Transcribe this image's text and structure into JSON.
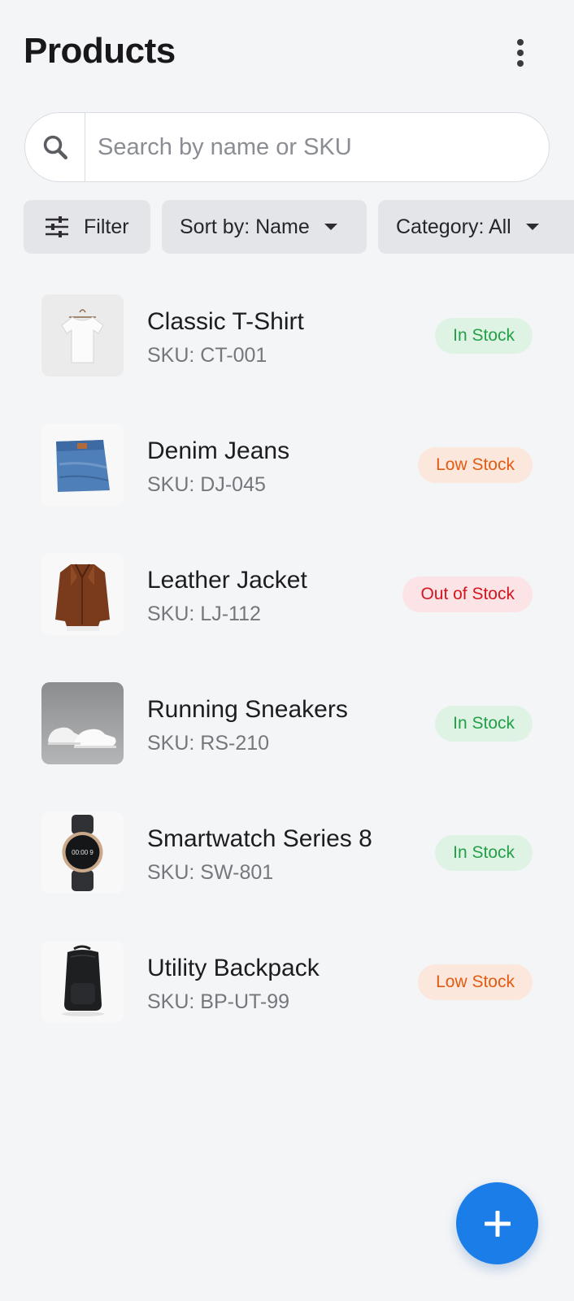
{
  "header": {
    "title": "Products",
    "more_icon": "more-vertical-icon"
  },
  "search": {
    "placeholder": "Search by name or SKU",
    "value": "",
    "icon": "search-icon"
  },
  "toolbar": {
    "filter_label": "Filter",
    "filter_icon": "sliders-icon",
    "sort_label": "Sort by: Name",
    "category_label": "Category: All"
  },
  "colors": {
    "accent": "#1b7ee8",
    "in_stock_bg": "#dff3e5",
    "in_stock_text": "#23a047",
    "low_stock_bg": "#fbe7dc",
    "low_stock_text": "#e25b12",
    "out_stock_bg": "#fbe3e6",
    "out_stock_text": "#d4161e"
  },
  "products": [
    {
      "name": "Classic T-Shirt",
      "sku": "SKU: CT-001",
      "status": "In Stock",
      "thumb": "t-shirt-image"
    },
    {
      "name": "Denim Jeans",
      "sku": "SKU: DJ-045",
      "status": "Low Stock",
      "thumb": "jeans-image"
    },
    {
      "name": "Leather Jacket",
      "sku": "SKU: LJ-112",
      "status": "Out of Stock",
      "thumb": "jacket-image"
    },
    {
      "name": "Running Sneakers",
      "sku": "SKU: RS-210",
      "status": "In Stock",
      "thumb": "sneakers-image"
    },
    {
      "name": "Smartwatch Series 8",
      "sku": "SKU: SW-801",
      "status": "In Stock",
      "thumb": "smartwatch-image",
      "watch_face": "00:00 9"
    },
    {
      "name": "Utility Backpack",
      "sku": "SKU: BP-UT-99",
      "status": "Low Stock",
      "thumb": "backpack-image"
    }
  ],
  "fab": {
    "icon": "plus-icon"
  }
}
